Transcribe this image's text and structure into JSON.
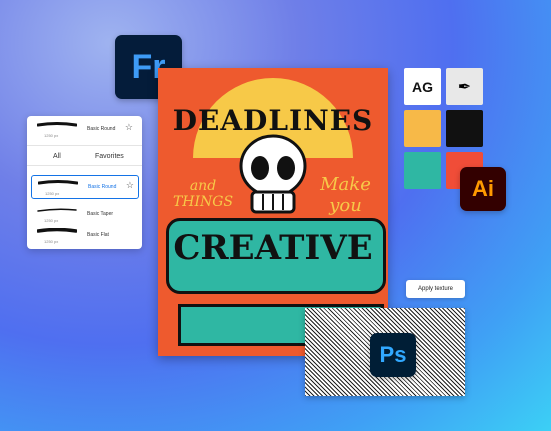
{
  "apps": {
    "fresco": {
      "label": "Fr"
    },
    "illustrator": {
      "label": "Ai"
    },
    "photoshop": {
      "label": "Ps"
    }
  },
  "brush_panel": {
    "top_item": {
      "name": "Basic Round",
      "size": "1250 px"
    },
    "tabs": [
      "All",
      "Favorites"
    ],
    "items": [
      {
        "name": "Basic Round",
        "size": "1250 px",
        "selected": true
      },
      {
        "name": "Basic Taper",
        "size": "1250 px"
      },
      {
        "name": "Basic Flat",
        "size": "1250 px"
      }
    ]
  },
  "poster": {
    "line1": "DEADLINES",
    "line2_left": "and THINGS",
    "line2_right": "Make you",
    "line3": "CREATIVE"
  },
  "tool_panel": {
    "ag_label": "AG",
    "pen_icon": "pen-tool-icon",
    "colors": {
      "yellow": "#f7b948",
      "black": "#111111",
      "teal": "#2fb7a3",
      "orange": "#f04d38"
    }
  },
  "apply_texture": {
    "label": "Apply texture"
  }
}
